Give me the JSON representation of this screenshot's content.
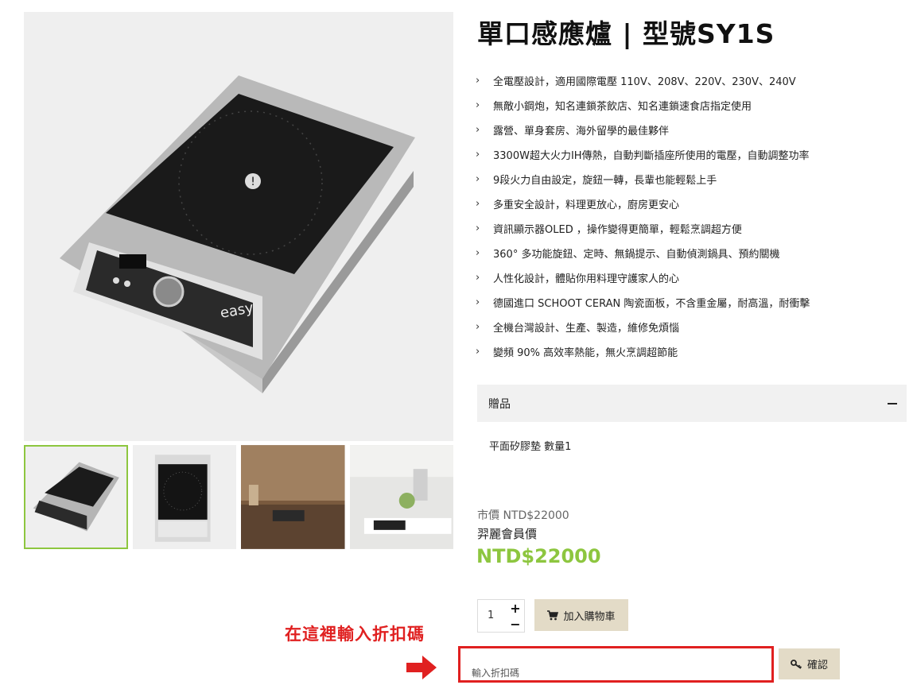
{
  "product": {
    "title": "單口感應爐 | 型號SY1S",
    "image_brand_text": "easy",
    "features": [
      "全電壓設計，適用國際電壓 110V、208V、220V、230V、240V",
      "無敵小鋼炮，知名連鎖茶飲店、知名連鎖速食店指定使用",
      "露營、單身套房、海外留學的最佳夥伴",
      "3300W超大火力IH傳熱，自動判斷插座所使用的電壓，自動調整功率",
      "9段火力自由設定，旋鈕一轉，長輩也能輕鬆上手",
      "多重安全設計，料理更放心，廚房更安心",
      "資訊顯示器OLED ，操作變得更簡單，輕鬆烹調超方便",
      "360° 多功能旋鈕、定時、無鍋提示、自動偵測鍋具、預約關機",
      "人性化設計，體貼你用料理守護家人的心",
      "德國進口 SCHOOT CERAN 陶瓷面板，不含重金屬，耐高溫，耐衝擊",
      "全機台灣設計、生產、製造，維修免煩惱",
      "變頻 90% 高效率熱能，無火烹調超節能"
    ]
  },
  "gift": {
    "header": "贈品",
    "content": "平面矽膠墊 數量1"
  },
  "pricing": {
    "market_price": "市價 NTD$22000",
    "member_label": "羿麗會員價",
    "member_price": "NTD$22000"
  },
  "cart": {
    "quantity": "1",
    "plus": "+",
    "minus": "−",
    "add_label": "加入購物車"
  },
  "coupon": {
    "annotation": "在這裡輸入折扣碼",
    "placeholder": "輸入折扣碼",
    "confirm_label": "確認"
  },
  "colors": {
    "accent_green": "#8dc63f",
    "button_beige": "#e3dbc7",
    "annotation_red": "#e02020"
  },
  "icons": {
    "feature_bullet": "chevron-right-icon",
    "cart": "shopping-cart-icon",
    "confirm": "key-icon",
    "arrow": "arrow-right-icon"
  }
}
